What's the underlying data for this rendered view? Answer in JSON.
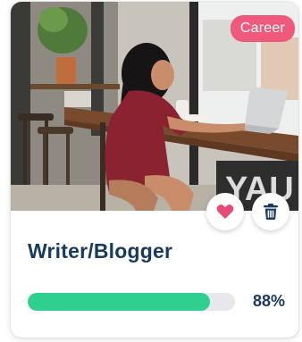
{
  "card": {
    "badge_label": "Career",
    "title": "Writer/Blogger",
    "progress": {
      "value": 0.88,
      "label": "88%"
    },
    "actions": {
      "favorite_icon": "heart-icon",
      "delete_icon": "trash-icon"
    },
    "image_alt": "Woman typing on laptop at a cafe window counter"
  },
  "colors": {
    "badge": "#ef5a7c",
    "title": "#173a5e",
    "progress_fill": "#2fcf8f",
    "progress_track": "#e6e8ec",
    "heart": "#e64a75",
    "trash": "#173a5e"
  }
}
